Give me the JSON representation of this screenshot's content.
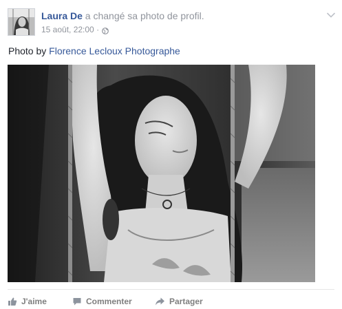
{
  "post": {
    "author": "Laura De",
    "action_text": " a changé sa photo de profil.",
    "timestamp": "15 août, 22:00 ·",
    "privacy_icon": "globe-icon",
    "options_icon": "chevron-down-icon",
    "caption_prefix": "Photo by ",
    "caption_link": "Florence Lecloux Photographe",
    "photo": {
      "description_icon": "profile-photo",
      "tone": "black-and-white"
    }
  },
  "actions": [
    {
      "label": "J'aime",
      "icon": "thumbs-up-icon"
    },
    {
      "label": "Commenter",
      "icon": "comment-icon"
    },
    {
      "label": "Partager",
      "icon": "share-icon"
    }
  ],
  "colors": {
    "link": "#365899",
    "secondary_text": "#90949c",
    "action_text": "#7f7f7f"
  }
}
